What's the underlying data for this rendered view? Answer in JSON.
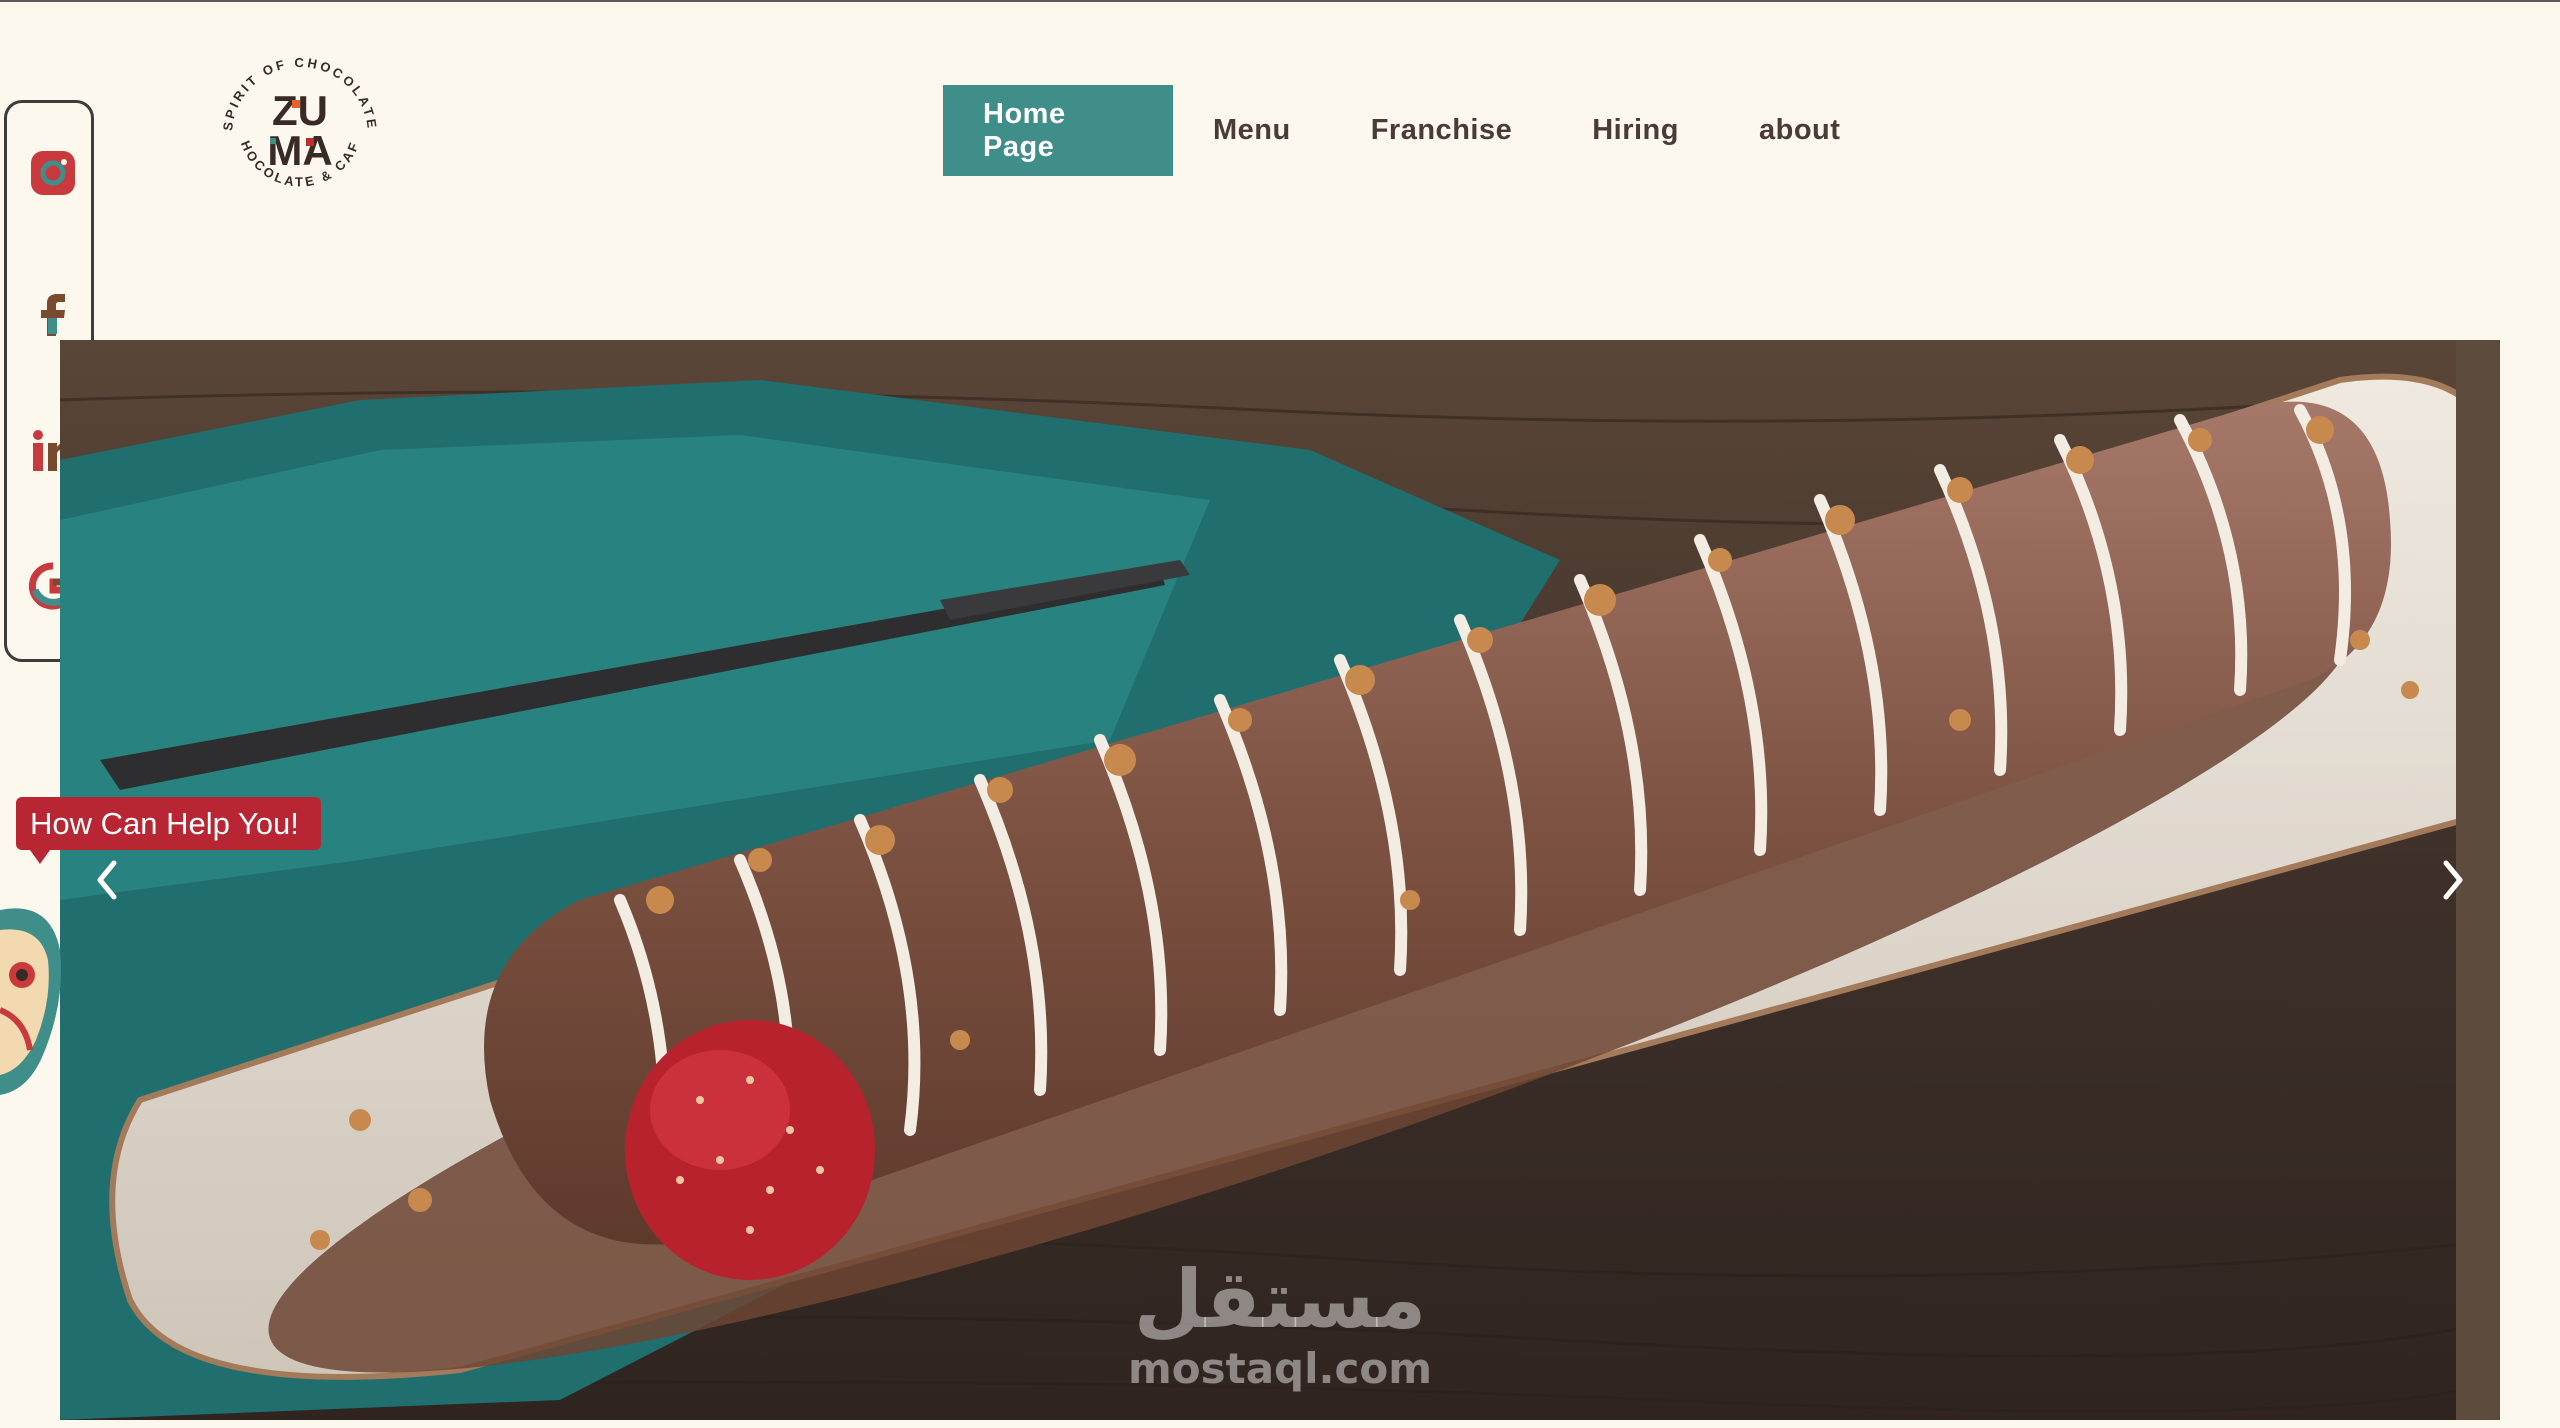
{
  "brand": {
    "name": "ZUMA",
    "tagline_top": "SPIRIT OF CHOCOLATE",
    "tagline_bottom": "CHOCOLATE & CAFE"
  },
  "nav": {
    "items": [
      {
        "label": "Home Page",
        "active": true
      },
      {
        "label": "Menu",
        "active": false
      },
      {
        "label": "Franchise",
        "active": false
      },
      {
        "label": "Hiring",
        "active": false
      },
      {
        "label": "about",
        "active": false
      }
    ]
  },
  "social": {
    "icons": [
      "instagram-icon",
      "facebook-icon",
      "linkedin-icon",
      "google-icon"
    ]
  },
  "help": {
    "text": "How Can Help You!"
  },
  "watermark": {
    "arabic": "مستقل",
    "latin": "mostaql.com"
  },
  "colors": {
    "background": "#fcf8ee",
    "accent": "#3f8e8a",
    "help_bubble": "#b92633",
    "nav_text": "#4a3b35"
  }
}
